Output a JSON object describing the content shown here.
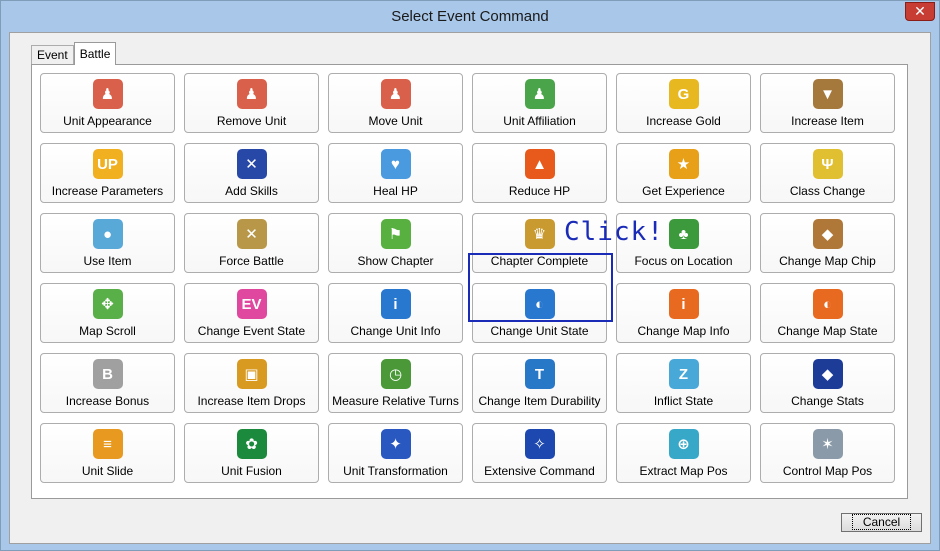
{
  "window": {
    "title": "Select Event Command",
    "close_glyph": "✕"
  },
  "tabs": [
    {
      "label": "Event"
    },
    {
      "label": "Battle"
    }
  ],
  "annotation": {
    "text": "Click!"
  },
  "footer": {
    "cancel_label": "Cancel"
  },
  "commands": [
    {
      "label": "Unit Appearance",
      "icon": "unit-appearance-icon",
      "color": "#d9604a",
      "glyph": "♟"
    },
    {
      "label": "Remove Unit",
      "icon": "remove-unit-icon",
      "color": "#d9604a",
      "glyph": "♟"
    },
    {
      "label": "Move Unit",
      "icon": "move-unit-icon",
      "color": "#d9604a",
      "glyph": "♟"
    },
    {
      "label": "Unit Affiliation",
      "icon": "unit-affiliation-icon",
      "color": "#4aa54a",
      "glyph": "♟"
    },
    {
      "label": "Increase Gold",
      "icon": "gold-coin-icon",
      "color": "#e8b820",
      "glyph": "G"
    },
    {
      "label": "Increase Item",
      "icon": "item-bag-icon",
      "color": "#a5783c",
      "glyph": "▼"
    },
    {
      "label": "Increase Parameters",
      "icon": "up-arrow-icon",
      "color": "#f0b020",
      "glyph": "UP"
    },
    {
      "label": "Add Skills",
      "icon": "crossed-swords-icon",
      "color": "#2848a8",
      "glyph": "✕"
    },
    {
      "label": "Heal HP",
      "icon": "potion-icon",
      "color": "#4a9ae0",
      "glyph": "♥"
    },
    {
      "label": "Reduce HP",
      "icon": "flame-icon",
      "color": "#e85a1c",
      "glyph": "▲"
    },
    {
      "label": "Get Experience",
      "icon": "exp-star-icon",
      "color": "#e8a018",
      "glyph": "★"
    },
    {
      "label": "Class Change",
      "icon": "wings-icon",
      "color": "#e0c030",
      "glyph": "Ψ"
    },
    {
      "label": "Use Item",
      "icon": "crystal-ball-icon",
      "color": "#58a8d8",
      "glyph": "●"
    },
    {
      "label": "Force Battle",
      "icon": "sword-shield-icon",
      "color": "#b89848",
      "glyph": "✕"
    },
    {
      "label": "Show Chapter",
      "icon": "chapter-flag-icon",
      "color": "#58b040",
      "glyph": "⚑"
    },
    {
      "label": "Chapter Complete",
      "icon": "crown-icon",
      "color": "#c89a30",
      "glyph": "♛"
    },
    {
      "label": "Focus on Location",
      "icon": "forest-icon",
      "color": "#3c9a3c",
      "glyph": "♣"
    },
    {
      "label": "Change Map Chip",
      "icon": "map-chip-icon",
      "color": "#b07838",
      "glyph": "◆"
    },
    {
      "label": "Map Scroll",
      "icon": "map-scroll-icon",
      "color": "#5ab048",
      "glyph": "✥"
    },
    {
      "label": "Change Event State",
      "icon": "event-state-icon",
      "color": "#e048a0",
      "glyph": "EV"
    },
    {
      "label": "Change Unit Info",
      "icon": "unit-info-icon",
      "color": "#2878d0",
      "glyph": "i"
    },
    {
      "label": "Change Unit State",
      "icon": "unit-state-icon",
      "color": "#2878d0",
      "glyph": "◐"
    },
    {
      "label": "Change Map Info",
      "icon": "map-info-icon",
      "color": "#e86a20",
      "glyph": "i"
    },
    {
      "label": "Change Map State",
      "icon": "map-state-icon",
      "color": "#e86a20",
      "glyph": "◐"
    },
    {
      "label": "Increase Bonus",
      "icon": "bonus-coin-icon",
      "color": "#a0a0a0",
      "glyph": "B"
    },
    {
      "label": "Increase Item Drops",
      "icon": "treasure-chest-icon",
      "color": "#d89a20",
      "glyph": "▣"
    },
    {
      "label": "Measure Relative Turns",
      "icon": "clock-icon",
      "color": "#4a9838",
      "glyph": "◷"
    },
    {
      "label": "Change Item Durability",
      "icon": "hammer-icon",
      "color": "#2878c8",
      "glyph": "T"
    },
    {
      "label": "Inflict State",
      "icon": "zzz-sleep-icon",
      "color": "#48a8d8",
      "glyph": "Z"
    },
    {
      "label": "Change Stats",
      "icon": "stats-gem-icon",
      "color": "#1c3c98",
      "glyph": "◆"
    },
    {
      "label": "Unit Slide",
      "icon": "unit-slide-icon",
      "color": "#e89a20",
      "glyph": "≡"
    },
    {
      "label": "Unit Fusion",
      "icon": "fusion-icon",
      "color": "#1c8a3c",
      "glyph": "✿"
    },
    {
      "label": "Unit Transformation",
      "icon": "transformation-icon",
      "color": "#2858c0",
      "glyph": "✦"
    },
    {
      "label": "Extensive Command",
      "icon": "extensive-command-icon",
      "color": "#1c48b0",
      "glyph": "✧"
    },
    {
      "label": "Extract Map Pos",
      "icon": "magnifier-icon",
      "color": "#38a8c8",
      "glyph": "⊕"
    },
    {
      "label": "Control Map Pos",
      "icon": "compass-icon",
      "color": "#8a9aa8",
      "glyph": "✶"
    }
  ]
}
